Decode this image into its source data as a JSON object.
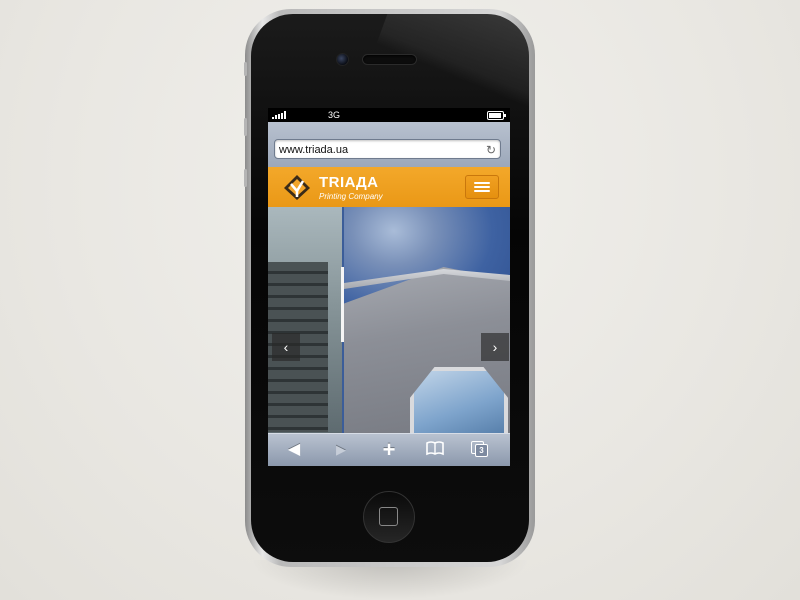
{
  "status_bar": {
    "network": "3G"
  },
  "browser": {
    "url": "www.triada.ua"
  },
  "site_header": {
    "brand_name": "TRIAДA",
    "brand_tagline": "Printing Company"
  },
  "slider": {
    "prev_label": "‹",
    "next_label": "›"
  },
  "toolbar": {
    "back_icon": "◀",
    "forward_icon": "▶",
    "add_icon": "+",
    "bookmarks_icon": "book-icon",
    "pages_count": "3"
  },
  "colors": {
    "brand_orange": "#f0a020",
    "browser_chrome": "#9ca8ba"
  }
}
